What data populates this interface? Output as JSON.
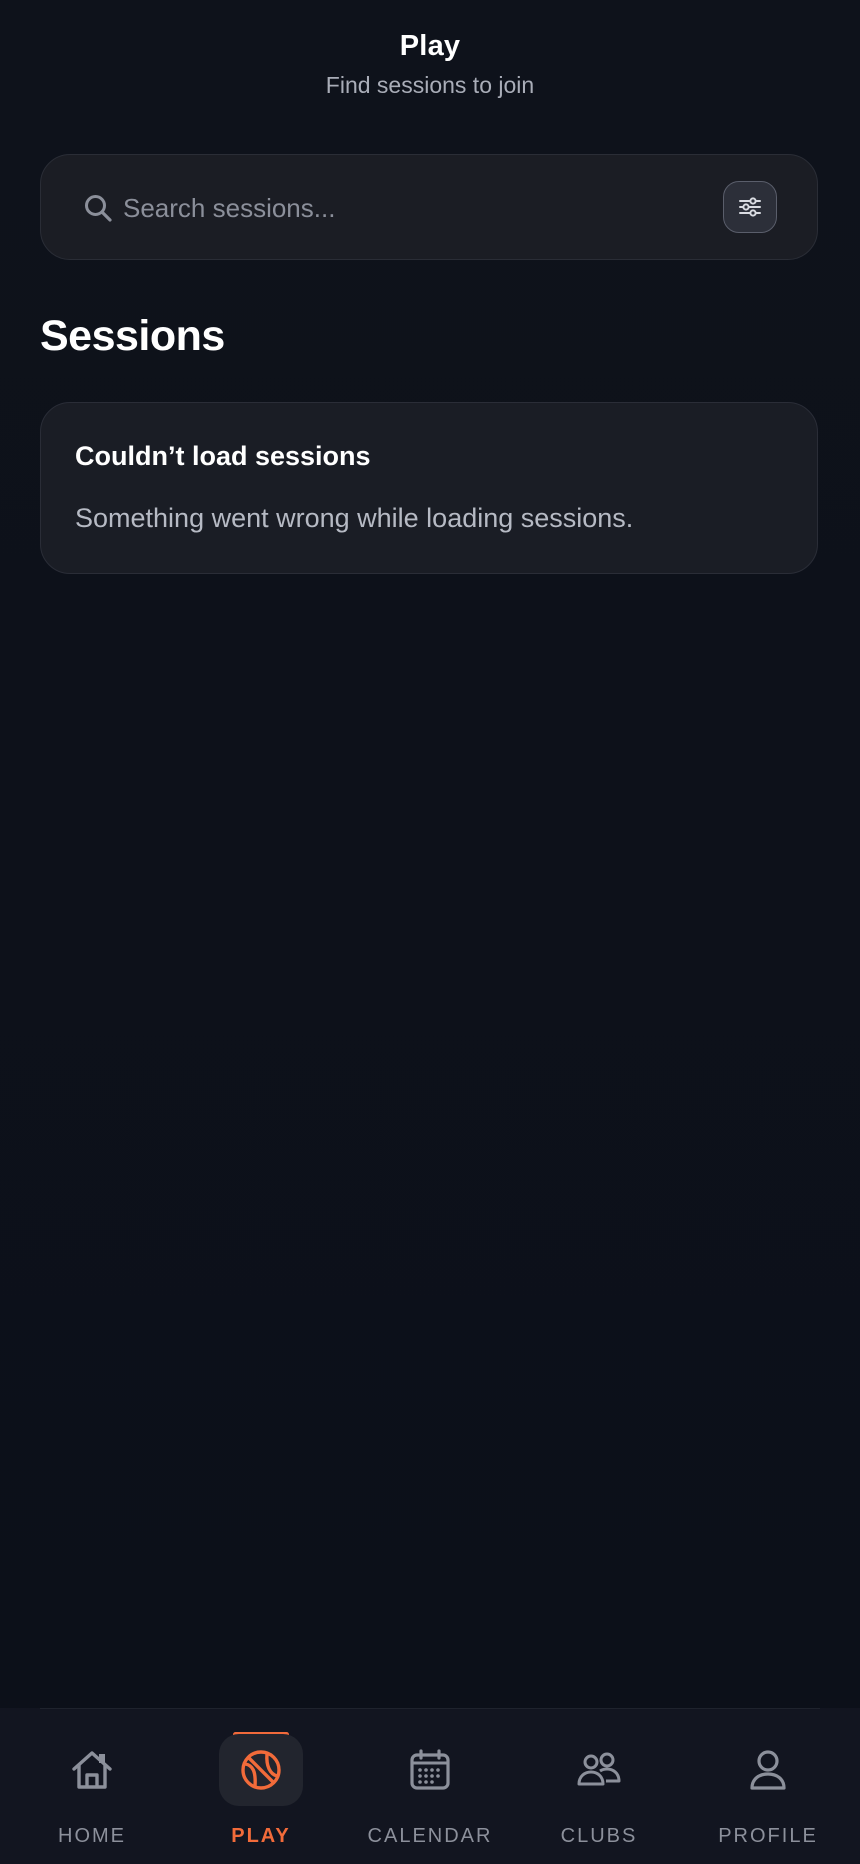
{
  "header": {
    "title": "Play",
    "subtitle": "Find sessions to join"
  },
  "search": {
    "placeholder": "Search sessions...",
    "value": "",
    "icon": "search-icon",
    "filter_icon": "sliders-icon"
  },
  "sessions": {
    "title": "Sessions",
    "error": {
      "title": "Couldn’t load sessions",
      "message": "Something went wrong while loading sessions."
    }
  },
  "tabbar": {
    "accent_color": "#f26b3a",
    "active_tab": "play",
    "tabs": [
      {
        "id": "home",
        "label": "HOME",
        "icon": "home-icon"
      },
      {
        "id": "play",
        "label": "PLAY",
        "icon": "ball-icon"
      },
      {
        "id": "calendar",
        "label": "CALENDAR",
        "icon": "calendar-icon"
      },
      {
        "id": "clubs",
        "label": "CLUBS",
        "icon": "users-icon"
      },
      {
        "id": "profile",
        "label": "PROFILE",
        "icon": "user-icon"
      }
    ]
  },
  "colors": {
    "background": "#0d111a",
    "card": "#1a1d25",
    "muted_text": "#a9adb8"
  }
}
